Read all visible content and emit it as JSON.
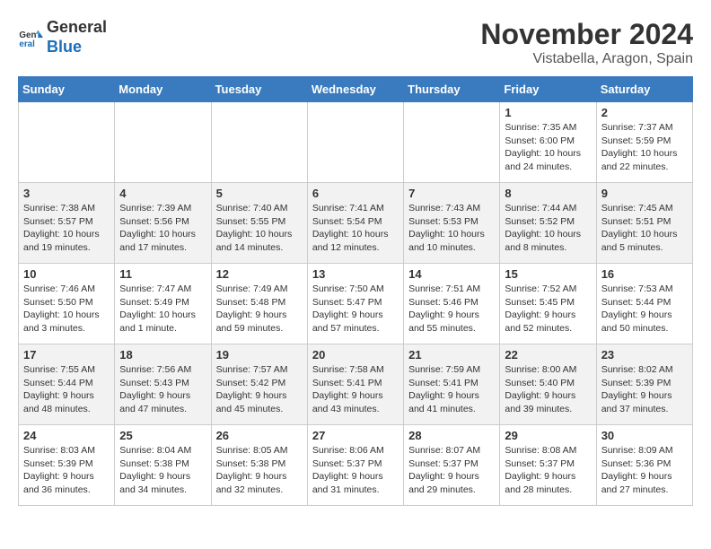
{
  "logo": {
    "general": "General",
    "blue": "Blue"
  },
  "header": {
    "month": "November 2024",
    "location": "Vistabella, Aragon, Spain"
  },
  "weekdays": [
    "Sunday",
    "Monday",
    "Tuesday",
    "Wednesday",
    "Thursday",
    "Friday",
    "Saturday"
  ],
  "weeks": [
    [
      {
        "day": "",
        "info": ""
      },
      {
        "day": "",
        "info": ""
      },
      {
        "day": "",
        "info": ""
      },
      {
        "day": "",
        "info": ""
      },
      {
        "day": "",
        "info": ""
      },
      {
        "day": "1",
        "info": "Sunrise: 7:35 AM\nSunset: 6:00 PM\nDaylight: 10 hours and 24 minutes."
      },
      {
        "day": "2",
        "info": "Sunrise: 7:37 AM\nSunset: 5:59 PM\nDaylight: 10 hours and 22 minutes."
      }
    ],
    [
      {
        "day": "3",
        "info": "Sunrise: 7:38 AM\nSunset: 5:57 PM\nDaylight: 10 hours and 19 minutes."
      },
      {
        "day": "4",
        "info": "Sunrise: 7:39 AM\nSunset: 5:56 PM\nDaylight: 10 hours and 17 minutes."
      },
      {
        "day": "5",
        "info": "Sunrise: 7:40 AM\nSunset: 5:55 PM\nDaylight: 10 hours and 14 minutes."
      },
      {
        "day": "6",
        "info": "Sunrise: 7:41 AM\nSunset: 5:54 PM\nDaylight: 10 hours and 12 minutes."
      },
      {
        "day": "7",
        "info": "Sunrise: 7:43 AM\nSunset: 5:53 PM\nDaylight: 10 hours and 10 minutes."
      },
      {
        "day": "8",
        "info": "Sunrise: 7:44 AM\nSunset: 5:52 PM\nDaylight: 10 hours and 8 minutes."
      },
      {
        "day": "9",
        "info": "Sunrise: 7:45 AM\nSunset: 5:51 PM\nDaylight: 10 hours and 5 minutes."
      }
    ],
    [
      {
        "day": "10",
        "info": "Sunrise: 7:46 AM\nSunset: 5:50 PM\nDaylight: 10 hours and 3 minutes."
      },
      {
        "day": "11",
        "info": "Sunrise: 7:47 AM\nSunset: 5:49 PM\nDaylight: 10 hours and 1 minute."
      },
      {
        "day": "12",
        "info": "Sunrise: 7:49 AM\nSunset: 5:48 PM\nDaylight: 9 hours and 59 minutes."
      },
      {
        "day": "13",
        "info": "Sunrise: 7:50 AM\nSunset: 5:47 PM\nDaylight: 9 hours and 57 minutes."
      },
      {
        "day": "14",
        "info": "Sunrise: 7:51 AM\nSunset: 5:46 PM\nDaylight: 9 hours and 55 minutes."
      },
      {
        "day": "15",
        "info": "Sunrise: 7:52 AM\nSunset: 5:45 PM\nDaylight: 9 hours and 52 minutes."
      },
      {
        "day": "16",
        "info": "Sunrise: 7:53 AM\nSunset: 5:44 PM\nDaylight: 9 hours and 50 minutes."
      }
    ],
    [
      {
        "day": "17",
        "info": "Sunrise: 7:55 AM\nSunset: 5:44 PM\nDaylight: 9 hours and 48 minutes."
      },
      {
        "day": "18",
        "info": "Sunrise: 7:56 AM\nSunset: 5:43 PM\nDaylight: 9 hours and 47 minutes."
      },
      {
        "day": "19",
        "info": "Sunrise: 7:57 AM\nSunset: 5:42 PM\nDaylight: 9 hours and 45 minutes."
      },
      {
        "day": "20",
        "info": "Sunrise: 7:58 AM\nSunset: 5:41 PM\nDaylight: 9 hours and 43 minutes."
      },
      {
        "day": "21",
        "info": "Sunrise: 7:59 AM\nSunset: 5:41 PM\nDaylight: 9 hours and 41 minutes."
      },
      {
        "day": "22",
        "info": "Sunrise: 8:00 AM\nSunset: 5:40 PM\nDaylight: 9 hours and 39 minutes."
      },
      {
        "day": "23",
        "info": "Sunrise: 8:02 AM\nSunset: 5:39 PM\nDaylight: 9 hours and 37 minutes."
      }
    ],
    [
      {
        "day": "24",
        "info": "Sunrise: 8:03 AM\nSunset: 5:39 PM\nDaylight: 9 hours and 36 minutes."
      },
      {
        "day": "25",
        "info": "Sunrise: 8:04 AM\nSunset: 5:38 PM\nDaylight: 9 hours and 34 minutes."
      },
      {
        "day": "26",
        "info": "Sunrise: 8:05 AM\nSunset: 5:38 PM\nDaylight: 9 hours and 32 minutes."
      },
      {
        "day": "27",
        "info": "Sunrise: 8:06 AM\nSunset: 5:37 PM\nDaylight: 9 hours and 31 minutes."
      },
      {
        "day": "28",
        "info": "Sunrise: 8:07 AM\nSunset: 5:37 PM\nDaylight: 9 hours and 29 minutes."
      },
      {
        "day": "29",
        "info": "Sunrise: 8:08 AM\nSunset: 5:37 PM\nDaylight: 9 hours and 28 minutes."
      },
      {
        "day": "30",
        "info": "Sunrise: 8:09 AM\nSunset: 5:36 PM\nDaylight: 9 hours and 27 minutes."
      }
    ]
  ]
}
